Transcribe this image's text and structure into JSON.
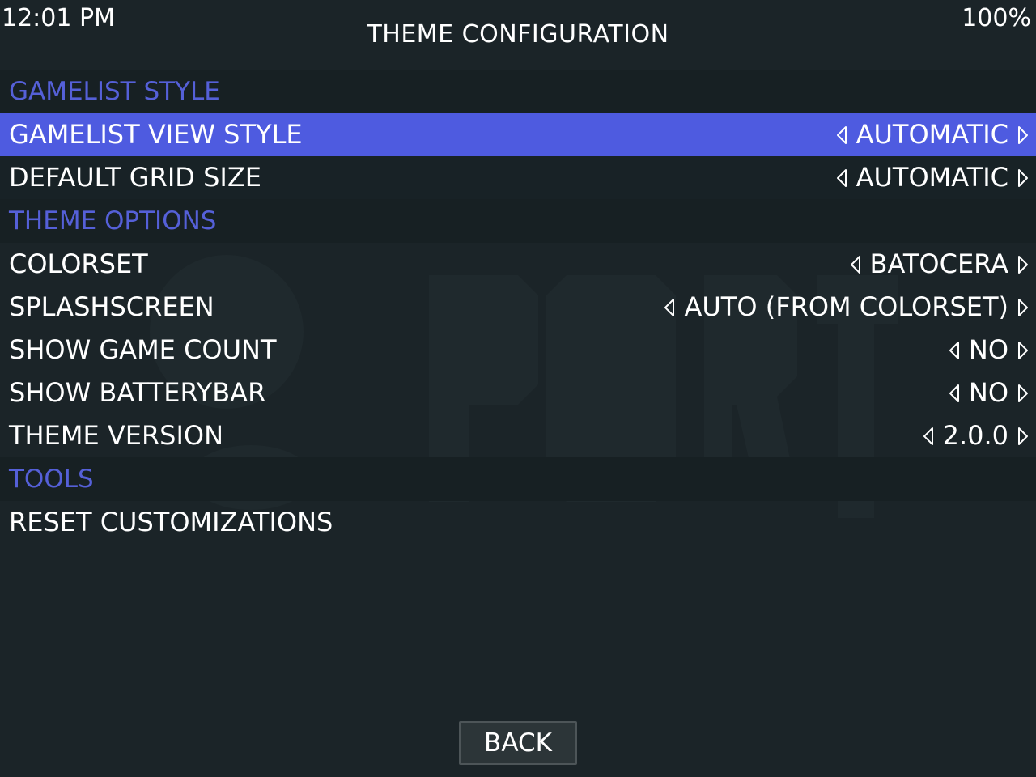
{
  "status": {
    "time": "12:01 PM",
    "battery": "100%"
  },
  "header": {
    "title": "THEME CONFIGURATION"
  },
  "sections": [
    {
      "title": "GAMELIST STYLE",
      "items": [
        {
          "label": "GAMELIST VIEW STYLE",
          "value": "AUTOMATIC",
          "selected": true
        },
        {
          "label": "DEFAULT GRID SIZE",
          "value": "AUTOMATIC"
        }
      ]
    },
    {
      "title": "THEME OPTIONS",
      "items": [
        {
          "label": "COLORSET",
          "value": "BATOCERA"
        },
        {
          "label": "SPLASHSCREEN",
          "value": "AUTO (FROM COLORSET)"
        },
        {
          "label": "SHOW GAME COUNT",
          "value": "NO"
        },
        {
          "label": "SHOW BATTERYBAR",
          "value": "NO"
        },
        {
          "label": "THEME VERSION",
          "value": "2.0.0"
        }
      ]
    },
    {
      "title": "TOOLS",
      "items": [
        {
          "label": "RESET CUSTOMIZATIONS"
        }
      ]
    }
  ],
  "footer": {
    "back_label": "BACK"
  },
  "colors": {
    "background": "#1b2428",
    "section_header_text": "#5560d8",
    "selected_row": "#4e5be0"
  },
  "icons": {
    "left_arrow": "triangle-left-outline-icon",
    "right_arrow": "triangle-right-outline-icon"
  }
}
